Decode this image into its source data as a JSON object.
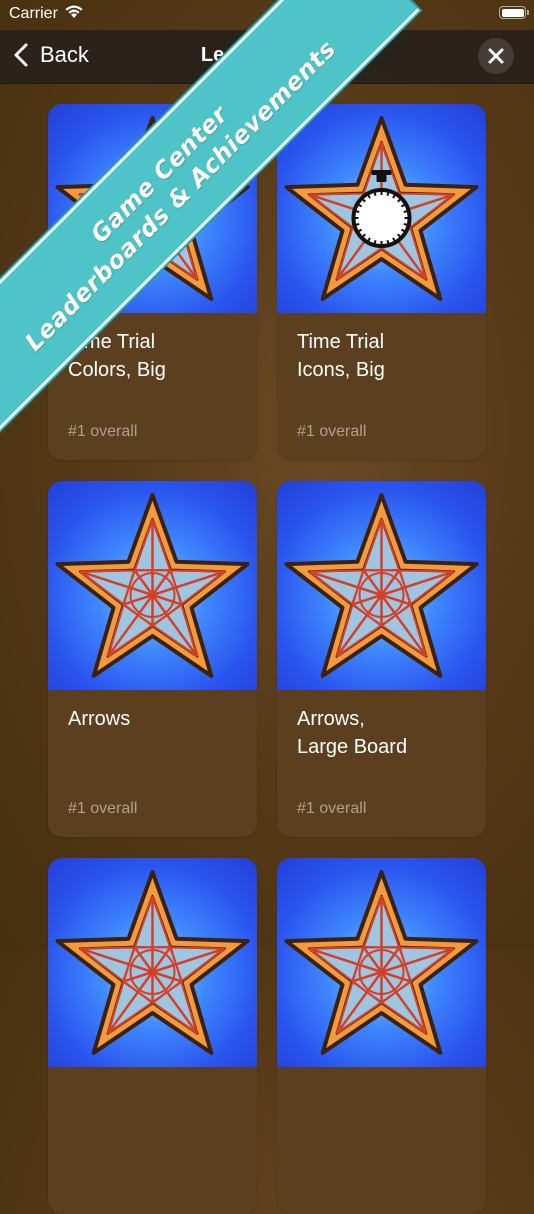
{
  "status_bar": {
    "carrier": "Carrier"
  },
  "nav": {
    "back_label": "Back",
    "title": "Leaderboards"
  },
  "banner": {
    "line1": "Game Center",
    "line2": "Leaderboards & Achievements"
  },
  "cards": [
    {
      "title": "Time Trial\nColors, Big",
      "rank": "#1 overall",
      "icon": "star-stopwatch-icon"
    },
    {
      "title": "Time Trial\nIcons, Big",
      "rank": "#1 overall",
      "icon": "star-stopwatch-icon"
    },
    {
      "title": "Arrows",
      "rank": "#1 overall",
      "icon": "star-icon"
    },
    {
      "title": "Arrows,\nLarge Board",
      "rank": "#1 overall",
      "icon": "star-icon"
    },
    {
      "title": "",
      "rank": "",
      "icon": "star-icon"
    },
    {
      "title": "",
      "rank": "",
      "icon": "star-icon"
    }
  ],
  "colors": {
    "banner": "#4fc4c8",
    "background": "#573a18",
    "card": "#5b3f1f",
    "thumb": "#2a54ee",
    "star": "#f39a3c"
  }
}
